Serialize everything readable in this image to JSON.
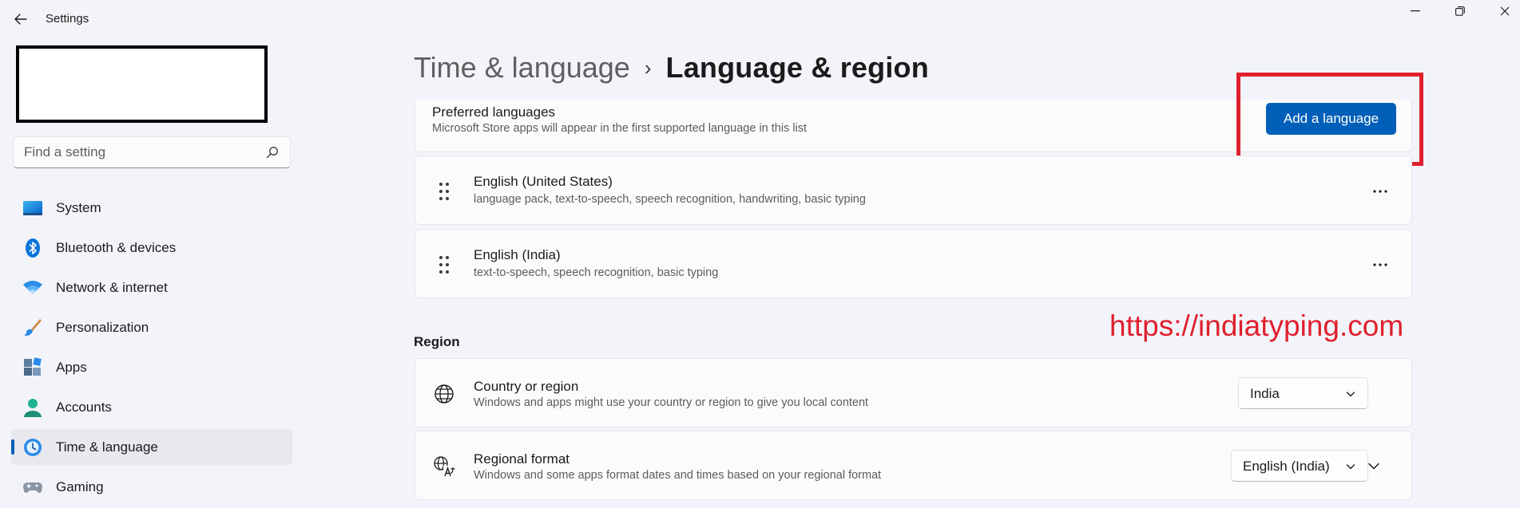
{
  "window": {
    "title": "Settings"
  },
  "search": {
    "placeholder": "Find a setting"
  },
  "sidebar": {
    "items": [
      {
        "label": "System",
        "icon": "system-icon"
      },
      {
        "label": "Bluetooth & devices",
        "icon": "bluetooth-icon"
      },
      {
        "label": "Network & internet",
        "icon": "wifi-icon"
      },
      {
        "label": "Personalization",
        "icon": "brush-icon"
      },
      {
        "label": "Apps",
        "icon": "apps-icon"
      },
      {
        "label": "Accounts",
        "icon": "account-icon"
      },
      {
        "label": "Time & language",
        "icon": "clock-globe-icon",
        "active": true
      },
      {
        "label": "Gaming",
        "icon": "gamepad-icon"
      }
    ]
  },
  "breadcrumb": {
    "parent": "Time & language",
    "separator": "›",
    "current": "Language & region"
  },
  "preferred": {
    "title": "Preferred languages",
    "subtitle": "Microsoft Store apps will appear in the first supported language in this list",
    "add_label": "Add a language"
  },
  "languages": [
    {
      "name": "English (United States)",
      "features": "language pack, text-to-speech, speech recognition, handwriting, basic typing"
    },
    {
      "name": "English (India)",
      "features": "text-to-speech, speech recognition, basic typing"
    }
  ],
  "region": {
    "section_title": "Region",
    "country": {
      "title": "Country or region",
      "subtitle": "Windows and apps might use your country or region to give you local content",
      "value": "India"
    },
    "format": {
      "title": "Regional format",
      "subtitle": "Windows and some apps format dates and times based on your regional format",
      "value": "English (India)"
    }
  },
  "watermark": "https://indiatyping.com",
  "colors": {
    "accent": "#005fb8",
    "highlight": "#e0202e"
  }
}
